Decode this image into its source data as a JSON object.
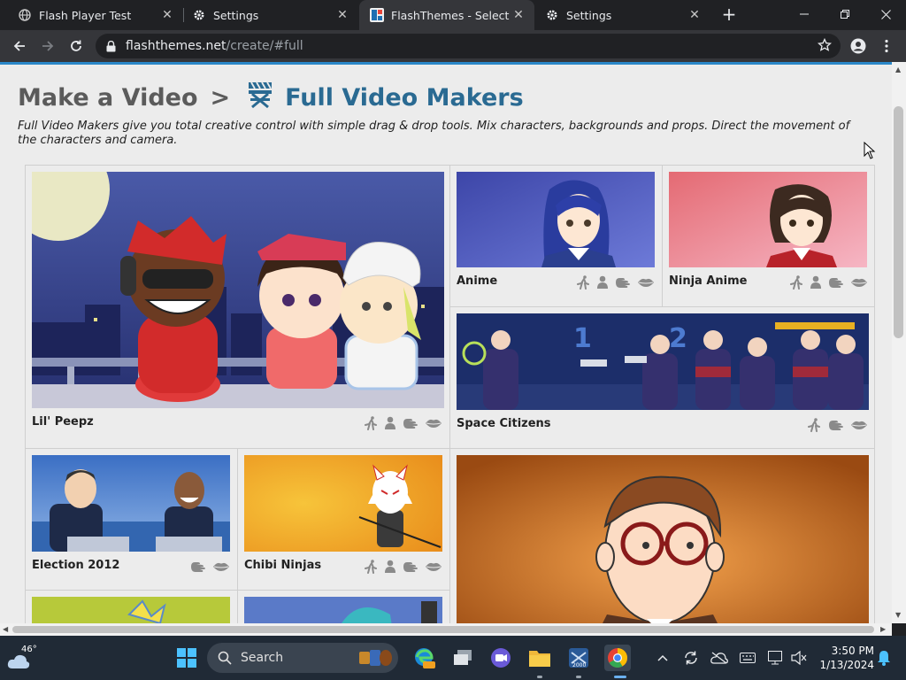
{
  "browser": {
    "tabs": [
      {
        "title": "Flash Player Test"
      },
      {
        "title": "Settings"
      },
      {
        "title": "FlashThemes - Select a Theme"
      },
      {
        "title": "Settings"
      }
    ],
    "url_host": "flashthemes.net",
    "url_path": "/create/#full"
  },
  "page": {
    "crumb_root": "Make a Video",
    "crumb_sep": ">",
    "crumb_current": "Full Video Makers",
    "intro": "Full Video Makers give you total creative control with simple drag & drop tools. Mix characters, backgrounds and props. Direct the movement of the characters and camera."
  },
  "themes": [
    {
      "name": "Lil' Peepz",
      "features": [
        "walk-icon",
        "person-icon",
        "hand-icon",
        "lips-icon"
      ]
    },
    {
      "name": "Anime",
      "features": [
        "walk-icon",
        "person-icon",
        "hand-icon",
        "lips-icon"
      ]
    },
    {
      "name": "Ninja Anime",
      "features": [
        "walk-icon",
        "person-icon",
        "hand-icon",
        "lips-icon"
      ]
    },
    {
      "name": "Space Citizens",
      "features": [
        "walk-icon",
        "hand-icon",
        "lips-icon"
      ]
    },
    {
      "name": "Election 2012",
      "features": [
        "hand-icon",
        "lips-icon"
      ]
    },
    {
      "name": "Chibi Ninjas",
      "features": [
        "walk-icon",
        "person-icon",
        "hand-icon",
        "lips-icon"
      ]
    },
    {
      "name": "",
      "features": []
    },
    {
      "name": "",
      "features": []
    },
    {
      "name": "",
      "features": []
    }
  ],
  "taskbar": {
    "temperature": "46°",
    "search_label": "Search",
    "time": "3:50 PM",
    "date": "1/13/2024"
  },
  "colors": {
    "accent_blue": "#2a87c8",
    "title_blue": "#2a6a92",
    "page_bg": "#ececec"
  }
}
